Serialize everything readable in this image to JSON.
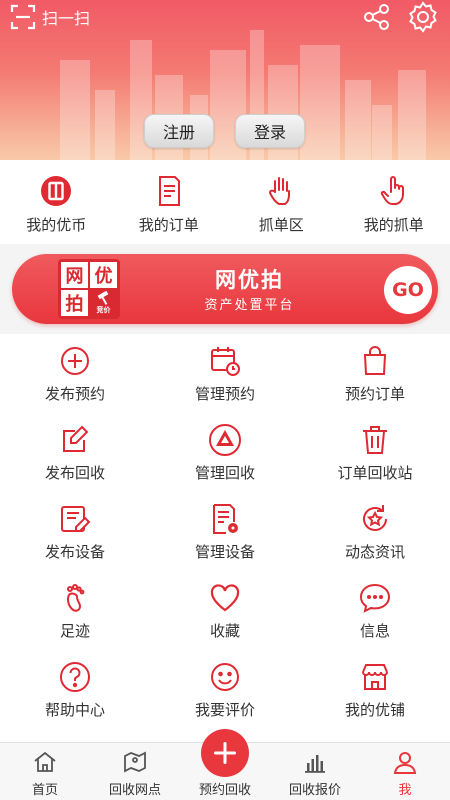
{
  "header": {
    "scan_label": "扫一扫",
    "register_label": "注册",
    "login_label": "登录"
  },
  "quick_items": [
    {
      "label": "我的优币",
      "icon": "coin-icon"
    },
    {
      "label": "我的订单",
      "icon": "order-icon"
    },
    {
      "label": "抓单区",
      "icon": "hand-icon"
    },
    {
      "label": "我的抓单",
      "icon": "pointer-hand-icon"
    }
  ],
  "banner": {
    "logo_chars": [
      "网",
      "优",
      "拍",
      "竞价"
    ],
    "title": "网优拍",
    "subtitle": "资产处置平台",
    "go_label": "GO"
  },
  "grid_items": [
    {
      "label": "发布预约",
      "icon": "plus-circle-icon"
    },
    {
      "label": "管理预约",
      "icon": "calendar-clock-icon"
    },
    {
      "label": "预约订单",
      "icon": "shopping-bag-icon"
    },
    {
      "label": "发布回收",
      "icon": "edit-icon"
    },
    {
      "label": "管理回收",
      "icon": "recycle-icon"
    },
    {
      "label": "订单回收站",
      "icon": "trash-icon"
    },
    {
      "label": "发布设备",
      "icon": "edit-list-icon"
    },
    {
      "label": "管理设备",
      "icon": "document-gear-icon"
    },
    {
      "label": "动态资讯",
      "icon": "refresh-star-icon"
    },
    {
      "label": "足迹",
      "icon": "footprint-icon"
    },
    {
      "label": "收藏",
      "icon": "heart-icon"
    },
    {
      "label": "信息",
      "icon": "chat-icon"
    },
    {
      "label": "帮助中心",
      "icon": "help-icon"
    },
    {
      "label": "我要评价",
      "icon": "smile-icon"
    },
    {
      "label": "我的优铺",
      "icon": "store-icon"
    }
  ],
  "bottom_nav": [
    {
      "label": "首页",
      "icon": "home-icon"
    },
    {
      "label": "回收网点",
      "icon": "map-pin-icon"
    },
    {
      "label": "预约回收",
      "icon": "plus-icon"
    },
    {
      "label": "回收报价",
      "icon": "bar-chart-icon"
    },
    {
      "label": "我",
      "icon": "user-icon"
    }
  ],
  "colors": {
    "accent": "#e8373d",
    "header_top": "#f15a66",
    "header_bottom": "#f9c9a8"
  }
}
